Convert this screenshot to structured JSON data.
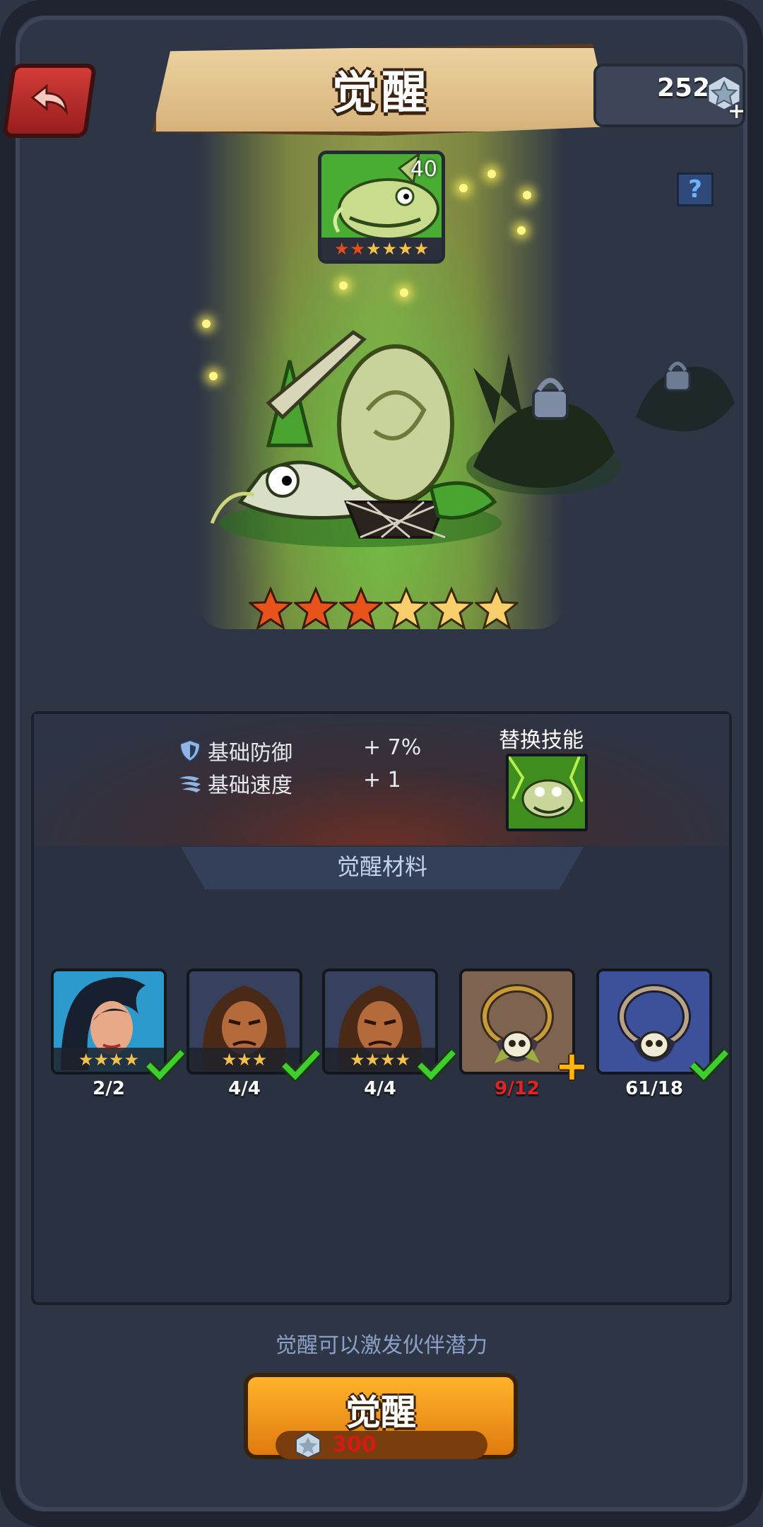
{
  "header": {
    "title": "觉醒",
    "back_icon": "back-arrow-icon",
    "currency_value": "252",
    "currency_icon": "star-gem-icon",
    "help_label": "?"
  },
  "hero": {
    "level": "40",
    "portrait_stars_filled": 2,
    "portrait_stars_total": 6,
    "awaken_stars_filled": 3,
    "awaken_stars_total": 6
  },
  "stats": {
    "items": [
      {
        "label": "基础防御",
        "value": "+ 7%",
        "icon": "shield-icon"
      },
      {
        "label": "基础速度",
        "value": "+ 1",
        "icon": "wing-speed-icon"
      }
    ],
    "skill_title": "替换技能"
  },
  "materials": {
    "header": "觉醒材料",
    "items": [
      {
        "count": "2/2",
        "stars": 4,
        "complete": true,
        "kind": "hero-female"
      },
      {
        "count": "4/4",
        "stars": 3,
        "complete": true,
        "kind": "hero-male"
      },
      {
        "count": "4/4",
        "stars": 4,
        "complete": true,
        "kind": "hero-male"
      },
      {
        "count": "9/12",
        "stars": 0,
        "complete": false,
        "kind": "skull-necklace-gold"
      },
      {
        "count": "61/18",
        "stars": 0,
        "complete": true,
        "kind": "skull-necklace-blue"
      }
    ]
  },
  "footer": {
    "hint": "觉醒可以激发伙伴潜力",
    "button_label": "觉醒",
    "cost": "300"
  },
  "colors": {
    "accent_orange": "#f0921c",
    "cost_red": "#d31a16",
    "shortage_red": "#e12323",
    "check_green": "#3ecf2e"
  }
}
